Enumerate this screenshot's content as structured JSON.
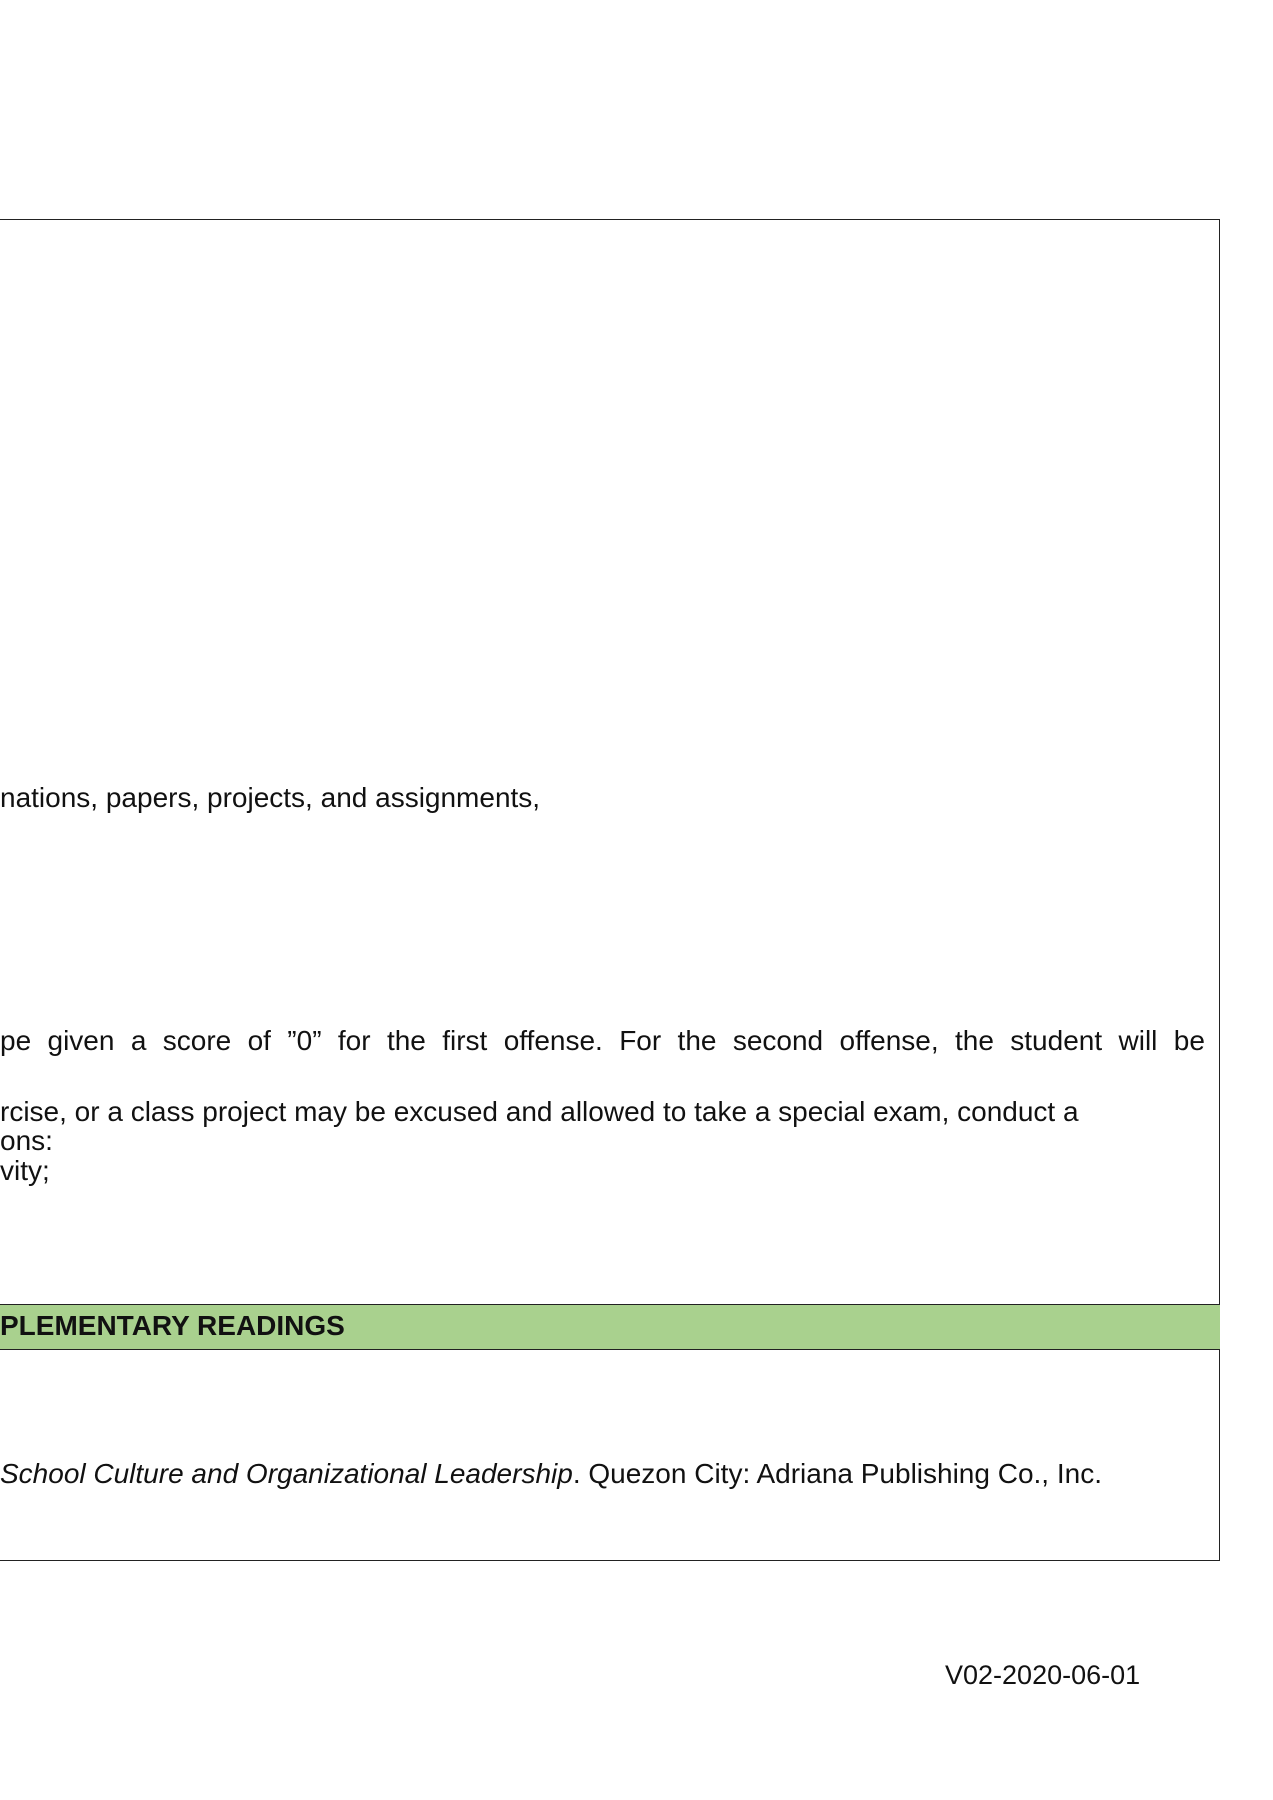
{
  "policies": {
    "line1": "nations, papers, projects, and assignments,",
    "line2_words": [
      "pe",
      "given",
      "a",
      "score",
      "of",
      "”0”",
      "for",
      "the",
      "first",
      "offense.",
      "For",
      "the",
      "second",
      "offense,",
      "the",
      "student",
      "will",
      "be"
    ],
    "line3": "rcise, or a class project may be excused and allowed to take a special exam, conduct a",
    "line4": "ons:",
    "line5": "vity;"
  },
  "readings": {
    "section_title": "PLEMENTARY READINGS",
    "reference_title": "School Culture and Organizational Leadership",
    "reference_rest": ". Quezon City: Adriana Publishing Co., Inc."
  },
  "footer": {
    "version": "V02-2020-06-01"
  },
  "colors": {
    "band": "#a9d18e",
    "border": "#222222"
  }
}
